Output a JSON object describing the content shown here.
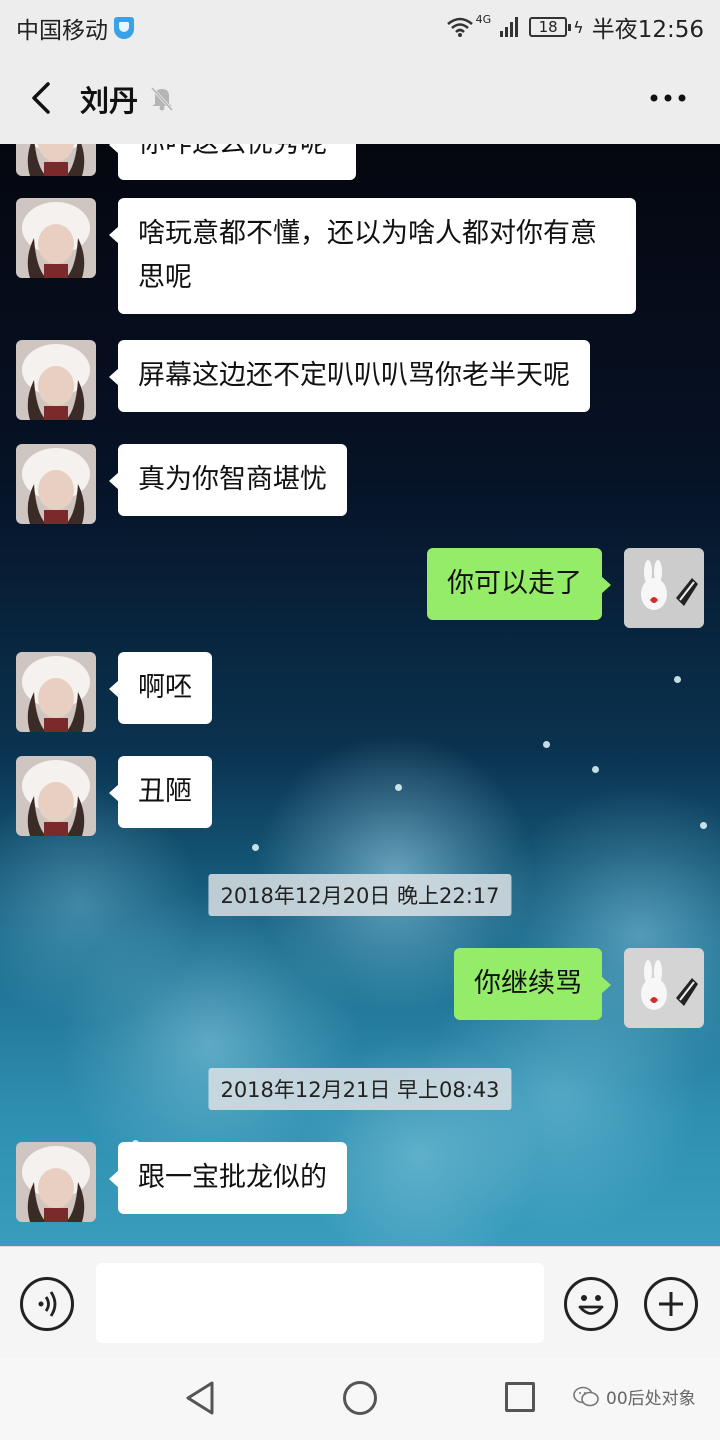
{
  "status_bar": {
    "carrier": "中国移动",
    "network": "4G",
    "battery": "18",
    "time": "半夜12:56"
  },
  "header": {
    "contact_name": "刘丹"
  },
  "messages": [
    {
      "side": "in",
      "text": "你咋这么优秀呢",
      "partial": true
    },
    {
      "side": "in",
      "text": "啥玩意都不懂，还以为啥人都对你有意思呢"
    },
    {
      "side": "in",
      "text": "屏幕这边还不定叭叭叭骂你老半天呢"
    },
    {
      "side": "in",
      "text": "真为你智商堪忧"
    },
    {
      "side": "out",
      "text": "你可以走了"
    },
    {
      "side": "in",
      "text": "啊呸"
    },
    {
      "side": "in",
      "text": "丑陋"
    },
    {
      "side": "out",
      "text": "你继续骂"
    },
    {
      "side": "in",
      "text": "跟一宝批龙似的"
    }
  ],
  "timestamps": [
    "2018年12月20日 晚上22:17",
    "2018年12月21日 早上08:43"
  ],
  "input_bar": {
    "text_value": ""
  },
  "watermark": "00后处对象",
  "colors": {
    "outgoing_bubble": "#95ec69",
    "incoming_bubble": "#ffffff",
    "chrome_bg": "#ededed"
  }
}
